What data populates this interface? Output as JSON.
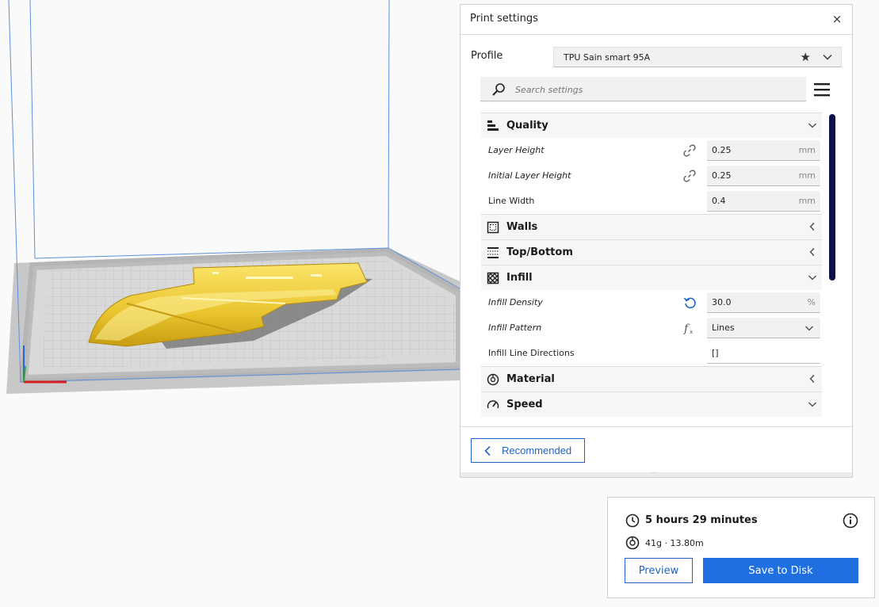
{
  "panel": {
    "title": "Print settings",
    "close_icon": "×"
  },
  "profile": {
    "label": "Profile",
    "value": "TPU Sain smart 95A"
  },
  "search": {
    "placeholder": "Search settings"
  },
  "settings": {
    "quality": {
      "label": "Quality",
      "layer_height": {
        "label": "Layer Height",
        "value": "0.25",
        "unit": "mm"
      },
      "initial_layer_height": {
        "label": "Initial Layer Height",
        "value": "0.25",
        "unit": "mm"
      },
      "line_width": {
        "label": "Line Width",
        "value": "0.4",
        "unit": "mm"
      }
    },
    "walls": {
      "label": "Walls"
    },
    "top_bottom": {
      "label": "Top/Bottom"
    },
    "infill": {
      "label": "Infill",
      "density": {
        "label": "Infill Density",
        "value": "30.0",
        "unit": "%"
      },
      "pattern": {
        "label": "Infill Pattern",
        "value": "Lines"
      },
      "line_directions": {
        "label": "Infill Line Directions",
        "value": "[]"
      }
    },
    "material": {
      "label": "Material"
    },
    "speed": {
      "label": "Speed"
    }
  },
  "footer": {
    "recommended_label": "Recommended"
  },
  "estimate": {
    "print_time": "5 hours 29 minutes",
    "material_usage": "41g · 13.80m",
    "preview_label": "Preview",
    "save_label": "Save to Disk"
  },
  "colors": {
    "accent": "#1f6fe0",
    "scrollbar": "#0e1149",
    "model": "#f2d13b"
  }
}
